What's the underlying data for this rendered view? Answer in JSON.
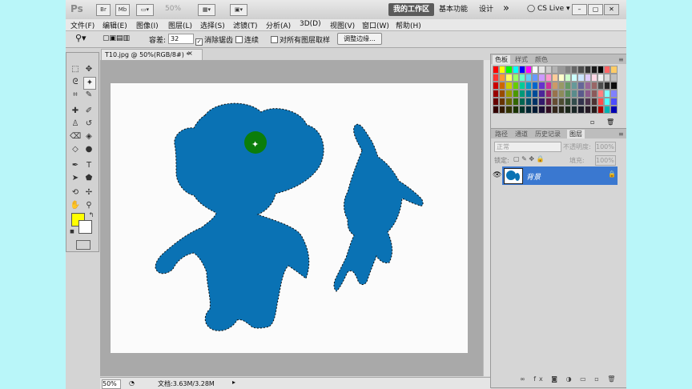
{
  "titlebar": {
    "logo": "Ps",
    "br_label": "Br",
    "mb_label": "Mb",
    "zoom": "50%",
    "workspaces": [
      "我的工作区",
      "基本功能",
      "设计"
    ],
    "more": "»",
    "cslive": "CS Live"
  },
  "menu": [
    "文件(F)",
    "编辑(E)",
    "图像(I)",
    "图层(L)",
    "选择(S)",
    "滤镜(T)",
    "分析(A)",
    "3D(D)",
    "视图(V)",
    "窗口(W)",
    "帮助(H)"
  ],
  "options": {
    "tolerance_label": "容差:",
    "tolerance_value": "32",
    "antialias_label": "消除锯齿",
    "contiguous_label": "连续",
    "sample_all_label": "对所有图层取样",
    "refine_edge_label": "调整边缘..."
  },
  "document": {
    "tab_title": "T10.jpg @ 50%(RGB/8#) *",
    "close_glyph": "×",
    "zoom_status": "50%",
    "doc_size": "文档:3.63M/3.28M"
  },
  "color_panel": {
    "tabs": [
      "色板",
      "样式",
      "颜色"
    ]
  },
  "layers_panel": {
    "tabs": [
      "路径",
      "通道",
      "历史记录",
      "图层"
    ],
    "blend_mode": "正常",
    "opacity_label": "不透明度:",
    "opacity_value": "100%",
    "lock_label": "锁定:",
    "fill_label": "填充:",
    "fill_value": "100%",
    "layer_name": "背景"
  },
  "colors": {
    "accent": "#3a78d0",
    "selection_fill": "#0a72b4",
    "foreground": "#ffff00",
    "background": "#ffffff",
    "cursor_ring": "#0b7d0b"
  },
  "swatches": [
    "#ff0000",
    "#ffff00",
    "#00ff00",
    "#00ffff",
    "#0000ff",
    "#ff00ff",
    "#ffffff",
    "#e6e6e6",
    "#cccccc",
    "#b3b3b3",
    "#999999",
    "#808080",
    "#666666",
    "#4d4d4d",
    "#333333",
    "#1a1a1a",
    "#000000",
    "#ff6666",
    "#ffcc66",
    "#ff3333",
    "#ff9933",
    "#ffff66",
    "#99ff66",
    "#66ffcc",
    "#66ccff",
    "#6699ff",
    "#cc99ff",
    "#ff99cc",
    "#ffcc99",
    "#ffffcc",
    "#ccffcc",
    "#ccffff",
    "#cce5ff",
    "#e0ccff",
    "#ffd9e6",
    "#f2f2f2",
    "#d9d9d9",
    "#bfbfbf",
    "#cc0000",
    "#cc6600",
    "#cccc00",
    "#66cc00",
    "#00cc99",
    "#0099cc",
    "#0066cc",
    "#6633cc",
    "#cc3399",
    "#cc9966",
    "#999966",
    "#669966",
    "#669999",
    "#666699",
    "#996699",
    "#996666",
    "#4d4d4d",
    "#262626",
    "#0d0d0d",
    "#990000",
    "#994c00",
    "#999900",
    "#4c9900",
    "#00997a",
    "#007399",
    "#004c99",
    "#4c2699",
    "#99266b",
    "#99734c",
    "#8c8c5a",
    "#5a8c5a",
    "#5a8c8c",
    "#5a5a8c",
    "#8c5a8c",
    "#8c5a5a",
    "#ff8080",
    "#80ffff",
    "#8080ff",
    "#660000",
    "#663300",
    "#666600",
    "#336600",
    "#006652",
    "#004d66",
    "#003366",
    "#33196b",
    "#661a47",
    "#664d33",
    "#4d4d33",
    "#334d33",
    "#334d4d",
    "#33334d",
    "#4d334d",
    "#4d3333",
    "#ff4d4d",
    "#4dffff",
    "#4d4dff",
    "#330000",
    "#331a00",
    "#333300",
    "#1a3300",
    "#003329",
    "#002633",
    "#001a33",
    "#190d33",
    "#330d24",
    "#33261a",
    "#262619",
    "#1a261a",
    "#1a2626",
    "#1a1a26",
    "#261a26",
    "#261a1a",
    "#b30000",
    "#00b3b3",
    "#0000b3"
  ]
}
